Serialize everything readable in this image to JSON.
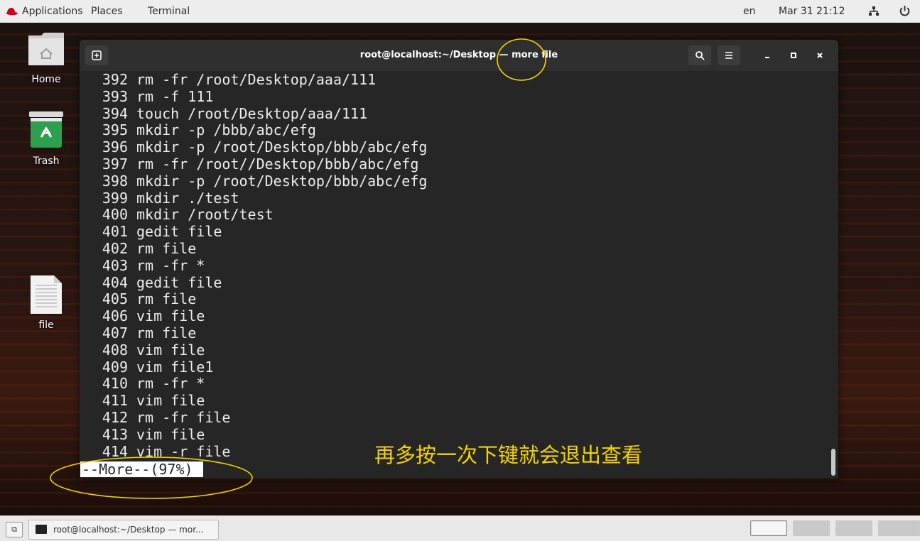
{
  "topbar": {
    "applications": "Applications",
    "places": "Places",
    "terminal": "Terminal",
    "language": "en",
    "datetime": "Mar 31 21:12",
    "network_icon": "network-icon",
    "power_icon": "power-icon"
  },
  "desktop": {
    "icons": [
      {
        "label": "Home",
        "icon": "home-folder-icon"
      },
      {
        "label": "Trash",
        "icon": "trash-icon"
      },
      {
        "label": "file",
        "icon": "text-file-icon"
      }
    ]
  },
  "terminal": {
    "title": "root@localhost:~/Desktop — more file",
    "lines": [
      {
        "num": "392",
        "cmd": "rm -fr /root/Desktop/aaa/111"
      },
      {
        "num": "393",
        "cmd": "rm -f 111"
      },
      {
        "num": "394",
        "cmd": "touch /root/Desktop/aaa/111"
      },
      {
        "num": "395",
        "cmd": "mkdir -p /bbb/abc/efg"
      },
      {
        "num": "396",
        "cmd": "mkdir -p /root/Desktop/bbb/abc/efg"
      },
      {
        "num": "397",
        "cmd": "rm -fr /root//Desktop/bbb/abc/efg"
      },
      {
        "num": "398",
        "cmd": "mkdir -p /root/Desktop/bbb/abc/efg"
      },
      {
        "num": "399",
        "cmd": "mkdir ./test"
      },
      {
        "num": "400",
        "cmd": "mkdir /root/test"
      },
      {
        "num": "401",
        "cmd": "gedit file"
      },
      {
        "num": "402",
        "cmd": "rm file"
      },
      {
        "num": "403",
        "cmd": "rm -fr *"
      },
      {
        "num": "404",
        "cmd": "gedit file"
      },
      {
        "num": "405",
        "cmd": "rm file"
      },
      {
        "num": "406",
        "cmd": "vim file"
      },
      {
        "num": "407",
        "cmd": "rm file"
      },
      {
        "num": "408",
        "cmd": "vim file"
      },
      {
        "num": "409",
        "cmd": "vim file1"
      },
      {
        "num": "410",
        "cmd": "rm -fr *"
      },
      {
        "num": "411",
        "cmd": "vim file"
      },
      {
        "num": "412",
        "cmd": "rm -fr file"
      },
      {
        "num": "413",
        "cmd": "vim file"
      },
      {
        "num": "414",
        "cmd": "vim -r file"
      }
    ],
    "more_prompt": "--More--(97%)",
    "scroll_position": 0.97
  },
  "annotation": {
    "text": "再多按一次下键就会退出查看",
    "color": "#f5d300"
  },
  "taskbar": {
    "window_label": "root@localhost:~/Desktop — mor...",
    "workspaces": 4,
    "active_workspace": 1
  }
}
